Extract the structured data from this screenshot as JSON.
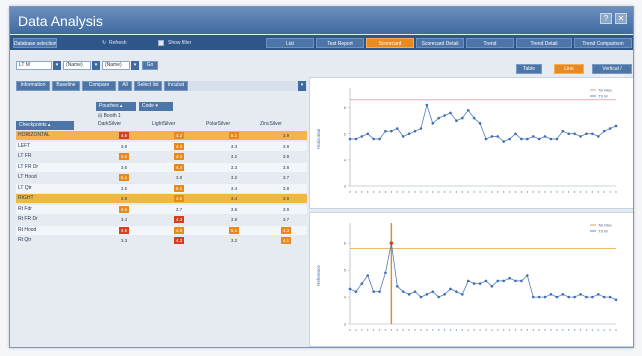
{
  "window": {
    "title": "Data Analysis",
    "help_glyph": "?",
    "close_glyph": "✕"
  },
  "nav": {
    "database_selection": "Database selection",
    "refresh": "Refresh",
    "show_filter": "Show filter",
    "tabs": [
      "List",
      "Test Report",
      "Scorecard",
      "Scorecard Detail",
      "Trend",
      "Trend Detail",
      "Trend Comparison"
    ],
    "active_tab": "Scorecard"
  },
  "filters": {
    "selects": [
      "LT M",
      "(Name)",
      "(Name)"
    ],
    "go": "Go",
    "buttons": [
      "Information",
      "Baseline",
      "Compare",
      "All",
      "Select list",
      "Incubat"
    ],
    "pill_columns": "Pouches",
    "pill_codes": "Code",
    "header_booth": "Booth 1",
    "colheads": [
      "DarkSilver",
      "LightSilver",
      "PolarSilver",
      "ZincSilver"
    ],
    "row_header": "Checkpoints"
  },
  "grid_rows": [
    {
      "label": "HORIZONTAL",
      "hl": true,
      "values": [
        "4.6",
        "4.2",
        "5.1",
        "3.9"
      ],
      "kinds": [
        "red",
        "org",
        "org",
        ""
      ]
    },
    {
      "label": "LEFT",
      "hl": false,
      "values": [
        "3.8",
        "4.3",
        "3.3",
        "3.8"
      ],
      "kinds": [
        "",
        "org",
        "",
        ""
      ]
    },
    {
      "label": "LT FR",
      "hl": false,
      "values": [
        "4.2",
        "4.2",
        "3.2",
        "3.9"
      ],
      "kinds": [
        "org",
        "org",
        "",
        ""
      ]
    },
    {
      "label": "LT FR Dr",
      "hl": false,
      "values": [
        "3.6",
        "4.4",
        "3.3",
        "3.8"
      ],
      "kinds": [
        "",
        "org",
        "",
        ""
      ]
    },
    {
      "label": "LT Hood",
      "hl": false,
      "values": [
        "5.1",
        "3.8",
        "3.2",
        "3.7"
      ],
      "kinds": [
        "org",
        "",
        "",
        ""
      ]
    },
    {
      "label": "LT Qtr",
      "hl": false,
      "values": [
        "3.5",
        "5.1",
        "3.4",
        "3.8"
      ],
      "kinds": [
        "",
        "org",
        "",
        ""
      ]
    },
    {
      "label": "RIGHT",
      "hl": true,
      "values": [
        "3.8",
        "4.5",
        "3.4",
        "3.9"
      ],
      "kinds": [
        "",
        "org",
        "",
        ""
      ]
    },
    {
      "label": "Rt Fdr",
      "hl": false,
      "values": [
        "4.5",
        "3.7",
        "3.6",
        "3.9"
      ],
      "kinds": [
        "org",
        "",
        "",
        ""
      ]
    },
    {
      "label": "Rt FR Dr",
      "hl": false,
      "values": [
        "3.4",
        "4.3",
        "3.9",
        "3.7"
      ],
      "kinds": [
        "",
        "red",
        "",
        ""
      ]
    },
    {
      "label": "Rt Hood",
      "hl": false,
      "values": [
        "4.5",
        "4.9",
        "5.1",
        "4.3"
      ],
      "kinds": [
        "red",
        "org",
        "org",
        "org"
      ]
    },
    {
      "label": "Rt Qtr",
      "hl": false,
      "values": [
        "3.3",
        "4.3",
        "3.2",
        "4.1"
      ],
      "kinds": [
        "",
        "red",
        "",
        "org"
      ]
    }
  ],
  "right": {
    "tabs": [
      "Table",
      "Line",
      "Vertical / Landscape"
    ],
    "active_tab": "Line"
  },
  "charts": [
    {
      "ylabel": "Horizontal",
      "legend": [
        "Tol Max",
        "TS M"
      ],
      "yticks": [
        "6",
        "5",
        "4",
        "3"
      ],
      "limit": 6.3,
      "limit_color": "#e87b7b",
      "line_color": "#3d6db5",
      "values": [
        4.8,
        4.8,
        4.9,
        5.0,
        4.8,
        4.8,
        5.1,
        5.1,
        5.2,
        4.9,
        5.0,
        5.1,
        5.2,
        6.1,
        5.4,
        5.6,
        5.7,
        5.8,
        5.5,
        5.6,
        5.9,
        5.6,
        5.4,
        4.8,
        4.9,
        4.9,
        4.7,
        4.8,
        5.0,
        4.8,
        4.8,
        4.9,
        4.8,
        4.9,
        4.8,
        4.8,
        5.1,
        5.0,
        5.0,
        4.9,
        5.0,
        5.0,
        4.9,
        5.1,
        5.2,
        5.3
      ]
    },
    {
      "ylabel": "Reference",
      "legend": [
        "Tol Max",
        "TS M"
      ],
      "yticks": [
        "6",
        "5",
        "4",
        "3"
      ],
      "limit": 5.8,
      "limit_color": "#e8891c",
      "highlight_index": 7,
      "line_color": "#3d6db5",
      "values": [
        4.3,
        4.2,
        4.5,
        4.8,
        4.2,
        4.2,
        4.9,
        6.0,
        4.4,
        4.2,
        4.1,
        4.2,
        4.0,
        4.1,
        4.2,
        4.0,
        4.1,
        4.3,
        4.2,
        4.1,
        4.6,
        4.5,
        4.5,
        4.6,
        4.4,
        4.6,
        4.6,
        4.7,
        4.6,
        4.6,
        4.8,
        4.0,
        4.0,
        4.0,
        4.1,
        4.0,
        4.1,
        4.0,
        4.0,
        4.1,
        4.0,
        4.0,
        4.1,
        4.0,
        4.0,
        3.9
      ]
    }
  ]
}
